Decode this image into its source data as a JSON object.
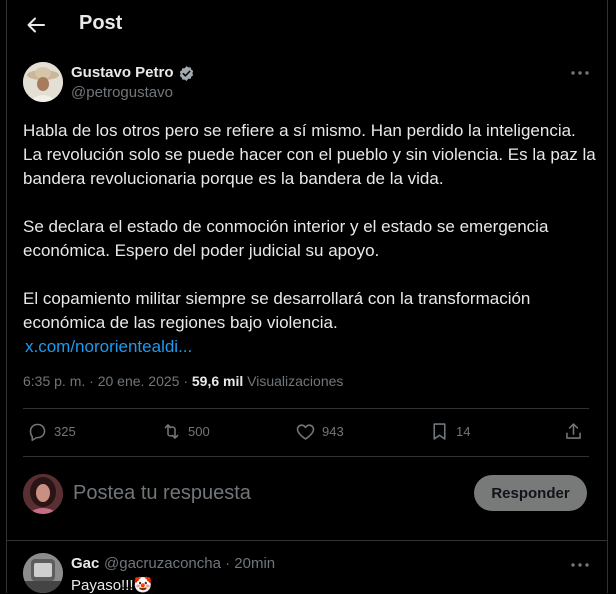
{
  "header": {
    "title": "Post"
  },
  "post": {
    "author_name": "Gustavo Petro",
    "handle": "@petrogustavo",
    "paragraphs": [
      "Habla de los otros pero se refiere a sí mismo. Han perdido la inteligencia. La revolución solo se puede hacer con el pueblo y sin violencia. Es la paz la bandera revolucionaria porque es la bandera de la vida.",
      "Se declara el estado de conmoción interior y el estado se emergencia económica. Espero del poder judicial su apoyo.",
      "El copamiento militar siempre se desarrollará con la transformación económica de las regiones bajo violencia."
    ],
    "link": "x.com/nororientealdi...",
    "timestamp": "6:35 p. m. · 20 ene. 2025 · ",
    "views_count": "59,6 mil",
    "views_label": " Visualizaciones",
    "stats": {
      "replies": "325",
      "reposts": "500",
      "likes": "943",
      "bookmarks": "14"
    }
  },
  "reply_box": {
    "placeholder": "Postea tu respuesta",
    "button_label": "Responder"
  },
  "comment": {
    "author_name": "Gac",
    "meta": "@gacruzaconcha · 20min",
    "text": "Payaso!!!🤡"
  },
  "colors": {
    "background": "#000000",
    "accent": "#1d9bf0",
    "muted": "#71767b",
    "text": "#e7e9ea",
    "border": "#2f3336"
  }
}
